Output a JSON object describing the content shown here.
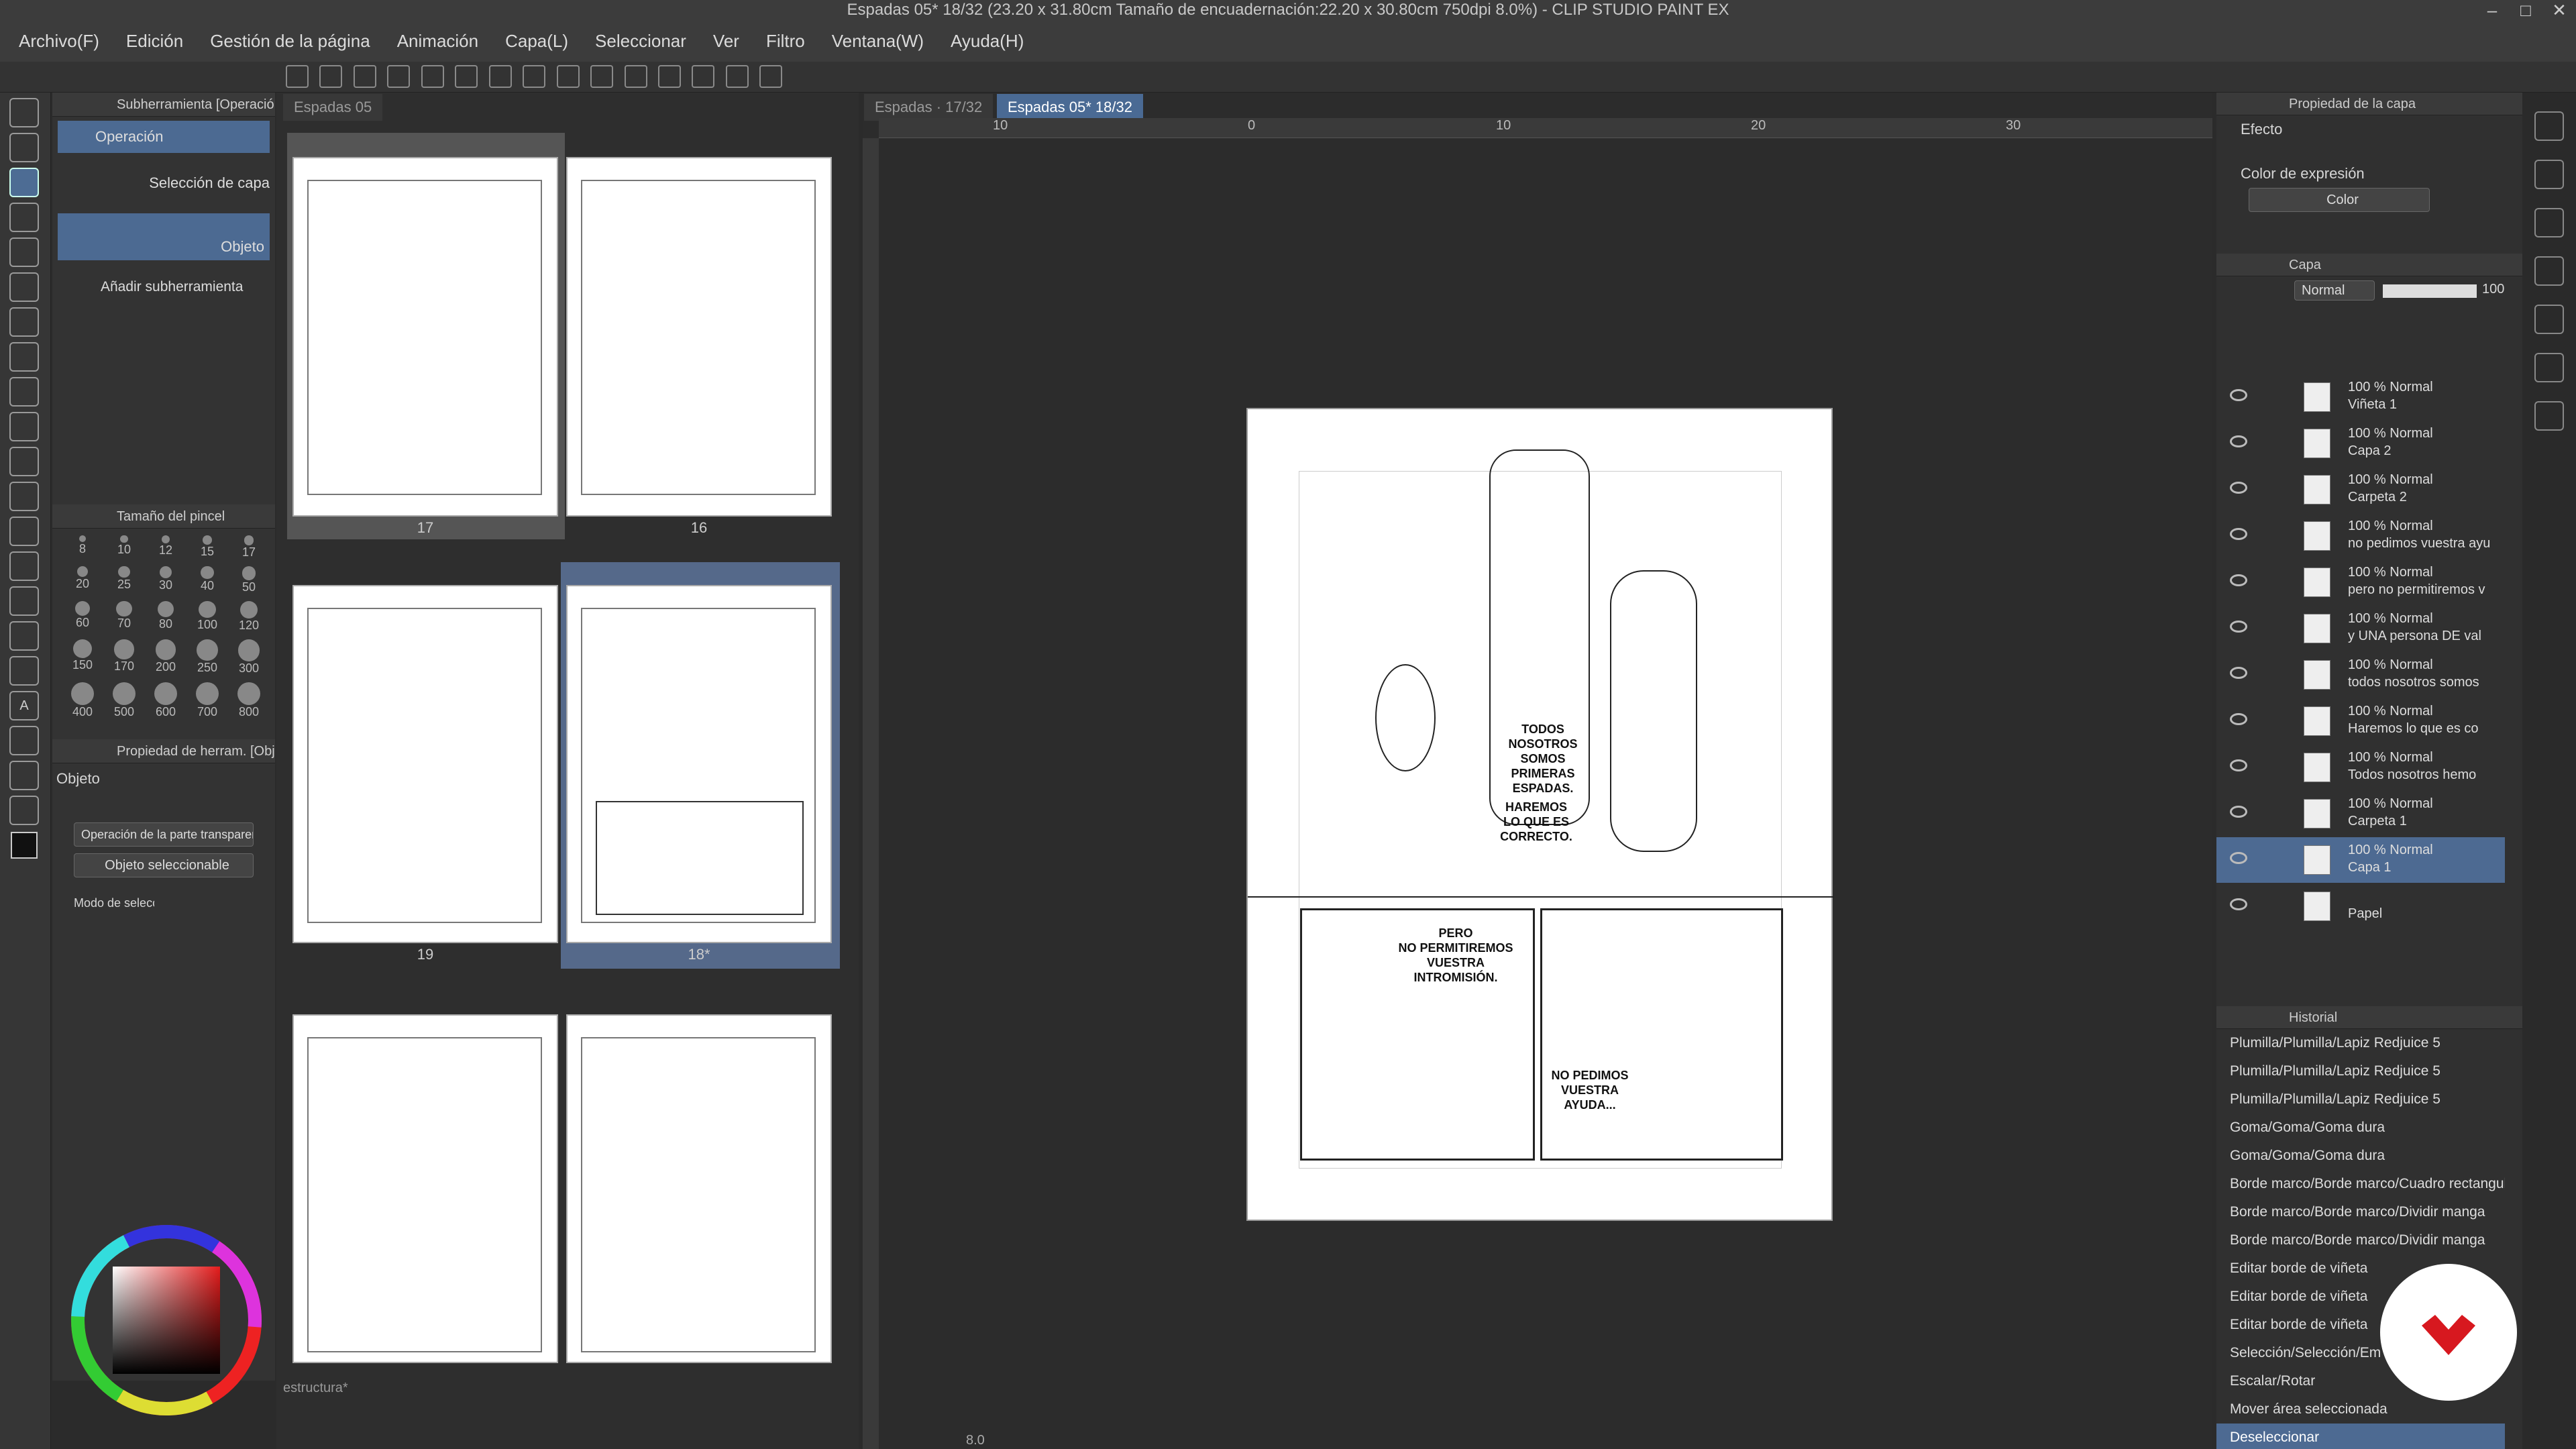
{
  "window": {
    "title": "Espadas 05* 18/32 (23.20 x 31.80cm Tamaño de encuadernación:22.20 x 30.80cm 750dpi 8.0%) - CLIP STUDIO PAINT EX"
  },
  "menu": [
    "Archivo(F)",
    "Edición",
    "Gestión de la página",
    "Animación",
    "Capa(L)",
    "Seleccionar",
    "Ver",
    "Filtro",
    "Ventana(W)",
    "Ayuda(H)"
  ],
  "subtool": {
    "header": "Subherramienta [Operación]",
    "operacion": "Operación",
    "seleccion_capa": "Selección de capa",
    "objeto": "Objeto",
    "add": "Añadir subherramienta"
  },
  "brush": {
    "header": "Tamaño del pincel",
    "sizes": [
      "8",
      "10",
      "12",
      "15",
      "17",
      "20",
      "25",
      "30",
      "40",
      "50",
      "60",
      "70",
      "80",
      "100",
      "120",
      "150",
      "170",
      "200",
      "250",
      "300",
      "400",
      "500",
      "600",
      "700",
      "800"
    ]
  },
  "toolprop": {
    "header": "Propiedad de herram. [Objeto]",
    "label": "Objeto",
    "dd1": "Operación de la parte transparente",
    "dd2": "Objeto seleccionable",
    "mode": "Modo de selección"
  },
  "pages": {
    "tab": "Espadas 05",
    "labels": [
      "17",
      "16",
      "19",
      "18*"
    ],
    "bottom_tab": "estructura*"
  },
  "canvas": {
    "tabs": [
      "Espadas · 17/32",
      "Espadas 05* 18/32"
    ],
    "ruler": [
      "10",
      "0",
      "10",
      "20",
      "30"
    ],
    "bubbles": [
      "TODOS\nNOSOTROS\nSOMOS\nPRIMERAS\nESPADAS.",
      "HAREMOS\nLO QUE ES\nCORRECTO.",
      "PERO\nNO PERMITIREMOS\nVUESTRA\nINTROMISIÓN.",
      "NO PEDIMOS\nVUESTRA\nAYUDA..."
    ],
    "zoom": "8.0"
  },
  "layerprop": {
    "header": "Propiedad de la capa",
    "efecto": "Efecto",
    "expr": "Color de expresión",
    "color": "Color"
  },
  "layers": {
    "header": "Capa",
    "blend": "Normal",
    "opacity": "100",
    "items": [
      {
        "t1": "100 % Normal",
        "t2": "Viñeta 1"
      },
      {
        "t1": "100 % Normal",
        "t2": "Capa 2"
      },
      {
        "t1": "100 % Normal",
        "t2": "Carpeta 2"
      },
      {
        "t1": "100 % Normal",
        "t2": "no pedimos vuestra ayu"
      },
      {
        "t1": "100 % Normal",
        "t2": "pero no permitiremos v"
      },
      {
        "t1": "100 % Normal",
        "t2": "y UNA persona DE val"
      },
      {
        "t1": "100 % Normal",
        "t2": "todos nosotros somos"
      },
      {
        "t1": "100 % Normal",
        "t2": "Haremos lo que es co"
      },
      {
        "t1": "100 % Normal",
        "t2": "Todos nosotros hemo"
      },
      {
        "t1": "100 % Normal",
        "t2": "Carpeta 1"
      },
      {
        "t1": "100 % Normal",
        "t2": "Capa 1"
      },
      {
        "t1": "",
        "t2": "Papel"
      }
    ]
  },
  "history": {
    "header": "Historial",
    "items": [
      "Plumilla/Plumilla/Lapiz Redjuice 5",
      "Plumilla/Plumilla/Lapiz Redjuice 5",
      "Plumilla/Plumilla/Lapiz Redjuice 5",
      "Goma/Goma/Goma dura",
      "Goma/Goma/Goma dura",
      "Borde marco/Borde marco/Cuadro rectangular",
      "Borde marco/Borde marco/Dividir manga",
      "Borde marco/Borde marco/Dividir manga",
      "Editar borde de viñeta",
      "Editar borde de viñeta",
      "Editar borde de viñeta",
      "Selección/Selección/Em",
      "Escalar/Rotar",
      "Mover área seleccionada",
      "Deseleccionar"
    ]
  }
}
